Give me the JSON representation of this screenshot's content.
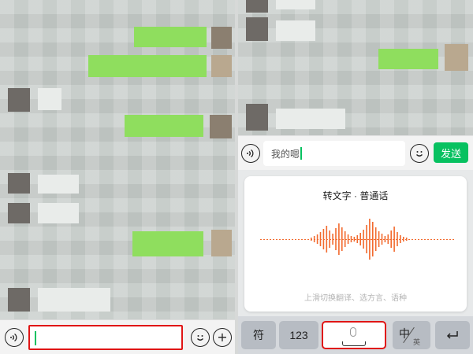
{
  "left_panel": {
    "input_value": ""
  },
  "right_panel": {
    "input_value": "我的嗯",
    "send_label": "发送",
    "voice_title": "转文字 · 普通话",
    "voice_hint": "上滑切换翻译、选方言、语种",
    "keys": {
      "symbol": "符",
      "numbers": "123",
      "chinese": "中",
      "english": "英",
      "return_icon": "return-icon"
    }
  },
  "icons": {
    "voice": "voice-icon",
    "emoji": "emoji-icon",
    "plus": "plus-icon",
    "mic": "microphone-icon"
  },
  "colors": {
    "send_green": "#07c160",
    "highlight_red": "#e01515",
    "wave_orange": "#f26a2e"
  }
}
